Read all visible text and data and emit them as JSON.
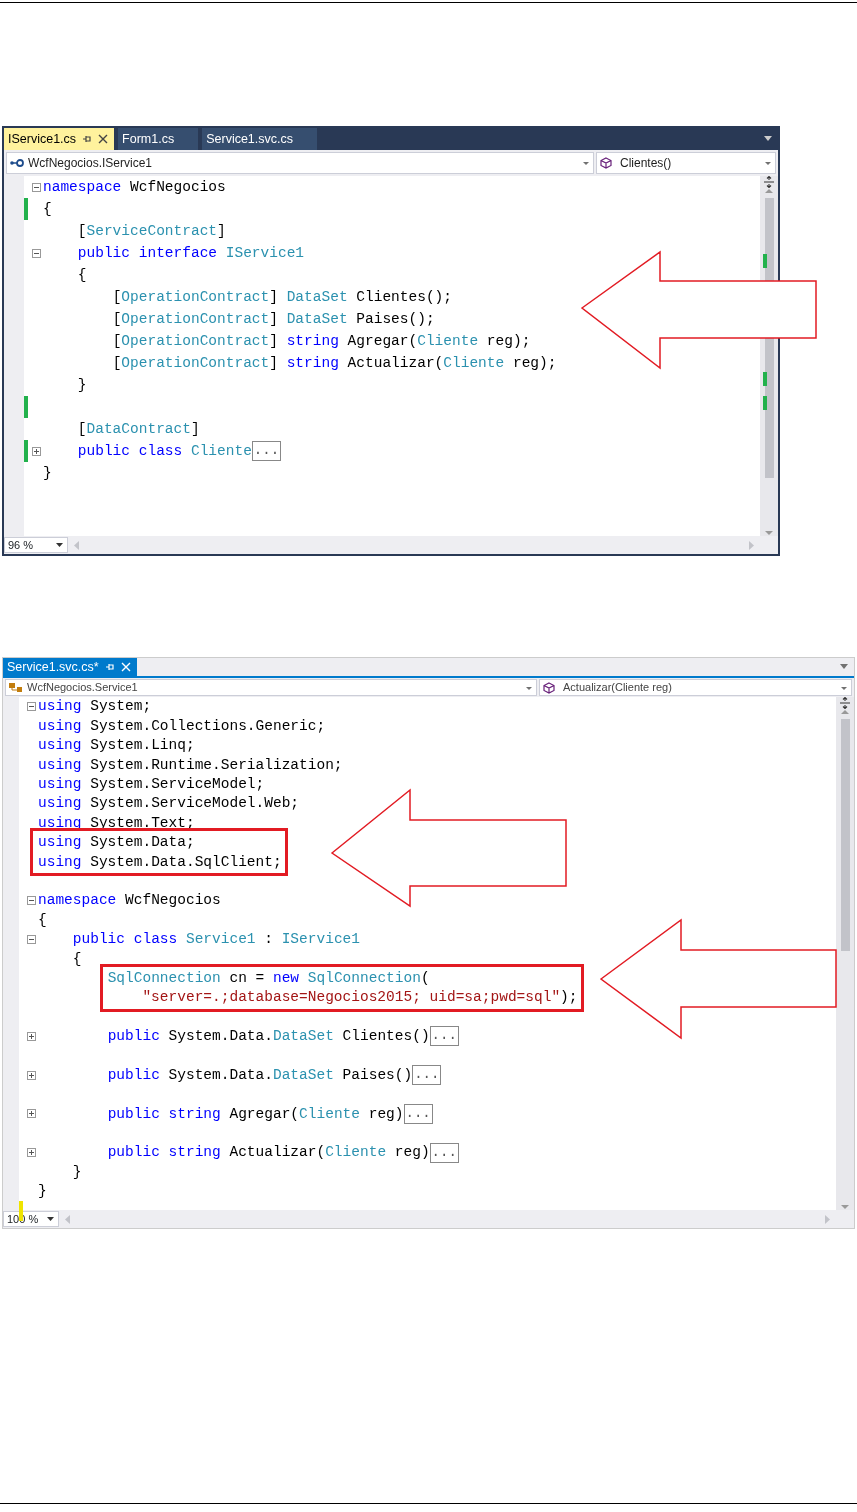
{
  "editors": [
    {
      "kind": "dark",
      "tabs": [
        {
          "label": "IService1.cs",
          "selected": true
        },
        {
          "label": "Form1.cs",
          "selected": false
        },
        {
          "label": "Service1.svc.cs",
          "selected": false
        }
      ],
      "type_dropdown": "WcfNegocios.IService1",
      "member_dropdown": "Clientes()",
      "zoom": "96 %",
      "blocks": [
        {
          "lines": [
            {
              "foldable": true,
              "expanded": true,
              "tokens": [
                {
                  "kind": "kw",
                  "text": "namespace"
                },
                {
                  "kind": "p",
                  "text": " WcfNegocios"
                }
              ]
            },
            {
              "modified": true,
              "saved": true,
              "tokens": [
                {
                  "kind": "p",
                  "text": "{"
                }
              ]
            },
            {
              "tokens": [
                {
                  "kind": "p",
                  "text": "    ["
                },
                {
                  "kind": "type",
                  "text": "ServiceContract"
                },
                {
                  "kind": "p",
                  "text": "]"
                }
              ]
            },
            {
              "foldable": true,
              "expanded": true,
              "tokens": [
                {
                  "kind": "kw",
                  "text": "    public interface"
                },
                {
                  "kind": "type",
                  "text": " IService1"
                }
              ]
            },
            {
              "tokens": [
                {
                  "kind": "p",
                  "text": "    {"
                }
              ]
            },
            {
              "tokens": [
                {
                  "kind": "p",
                  "text": "        ["
                },
                {
                  "kind": "type",
                  "text": "OperationContract"
                },
                {
                  "kind": "p",
                  "text": "]"
                },
                {
                  "kind": "type",
                  "text": " DataSet"
                },
                {
                  "kind": "p",
                  "text": " Clientes();"
                }
              ]
            },
            {
              "tokens": [
                {
                  "kind": "p",
                  "text": "        ["
                },
                {
                  "kind": "type",
                  "text": "OperationContract"
                },
                {
                  "kind": "p",
                  "text": "]"
                },
                {
                  "kind": "type",
                  "text": " DataSet"
                },
                {
                  "kind": "p",
                  "text": " Paises();"
                }
              ]
            },
            {
              "tokens": [
                {
                  "kind": "p",
                  "text": "        ["
                },
                {
                  "kind": "type",
                  "text": "OperationContract"
                },
                {
                  "kind": "p",
                  "text": "]"
                },
                {
                  "kind": "kw",
                  "text": " string"
                },
                {
                  "kind": "p",
                  "text": " Agregar("
                },
                {
                  "kind": "type",
                  "text": "Cliente"
                },
                {
                  "kind": "p",
                  "text": " reg);"
                }
              ]
            },
            {
              "tokens": [
                {
                  "kind": "p",
                  "text": "        ["
                },
                {
                  "kind": "type",
                  "text": "OperationContract"
                },
                {
                  "kind": "p",
                  "text": "]"
                },
                {
                  "kind": "kw",
                  "text": " string"
                },
                {
                  "kind": "p",
                  "text": " Actualizar("
                },
                {
                  "kind": "type",
                  "text": "Cliente"
                },
                {
                  "kind": "p",
                  "text": " reg);"
                }
              ]
            },
            {
              "tokens": [
                {
                  "kind": "p",
                  "text": "    }"
                }
              ]
            },
            {
              "modified": true,
              "saved": true
            },
            {
              "tokens": [
                {
                  "kind": "p",
                  "text": "    ["
                },
                {
                  "kind": "type",
                  "text": "DataContract"
                },
                {
                  "kind": "p",
                  "text": "]"
                }
              ]
            },
            {
              "modified": true,
              "saved": true,
              "foldable": true,
              "expanded": false,
              "tokens": [
                {
                  "kind": "kw",
                  "text": "    public class"
                },
                {
                  "kind": "type",
                  "text": " Cliente"
                },
                {
                  "kind": "collapsed",
                  "text": "..."
                }
              ]
            },
            {
              "tokens": [
                {
                  "kind": "p",
                  "text": "}"
                }
              ]
            }
          ]
        }
      ]
    },
    {
      "kind": "light",
      "tabs": [
        {
          "label": "Service1.svc.cs*",
          "selected": true
        }
      ],
      "type_dropdown": "WcfNegocios.Service1",
      "member_dropdown": "Actualizar(Cliente reg)",
      "zoom": "100 %",
      "blocks": [
        {
          "lines": [
            {
              "foldable": true,
              "expanded": true,
              "tokens": [
                {
                  "kind": "kw",
                  "text": "using"
                },
                {
                  "kind": "p",
                  "text": " System;"
                }
              ]
            },
            {
              "tokens": [
                {
                  "kind": "kw",
                  "text": "using"
                },
                {
                  "kind": "p",
                  "text": " System.Collections.Generic;"
                }
              ]
            },
            {
              "tokens": [
                {
                  "kind": "kw",
                  "text": "using"
                },
                {
                  "kind": "p",
                  "text": " System.Linq;"
                }
              ]
            },
            {
              "tokens": [
                {
                  "kind": "kw",
                  "text": "using"
                },
                {
                  "kind": "p",
                  "text": " System.Runtime.Serialization;"
                }
              ]
            },
            {
              "tokens": [
                {
                  "kind": "kw",
                  "text": "using"
                },
                {
                  "kind": "p",
                  "text": " System.ServiceModel;"
                }
              ]
            },
            {
              "tokens": [
                {
                  "kind": "kw",
                  "text": "using"
                },
                {
                  "kind": "p",
                  "text": " System.ServiceModel.Web;"
                }
              ]
            },
            {
              "tokens": [
                {
                  "kind": "kw",
                  "text": "using"
                },
                {
                  "kind": "p",
                  "text": " System.Text;"
                }
              ]
            },
            {
              "boxed": true,
              "tokens": [
                {
                  "kind": "kw",
                  "text": "using"
                },
                {
                  "kind": "p",
                  "text": " System.Data;"
                }
              ]
            },
            {
              "boxed": true,
              "tokens": [
                {
                  "kind": "kw",
                  "text": "using"
                },
                {
                  "kind": "p",
                  "text": " System.Data.SqlClient;"
                }
              ]
            }
          ]
        },
        {
          "lines": [
            {
              "foldable": true,
              "expanded": true,
              "tokens": [
                {
                  "kind": "kw",
                  "text": "namespace"
                },
                {
                  "kind": "p",
                  "text": " WcfNegocios"
                }
              ]
            },
            {
              "tokens": [
                {
                  "kind": "p",
                  "text": "{"
                }
              ]
            },
            {
              "foldable": true,
              "expanded": true,
              "tokens": [
                {
                  "kind": "kw",
                  "text": "    public class"
                },
                {
                  "kind": "type",
                  "text": " Service1"
                },
                {
                  "kind": "p",
                  "text": " :"
                },
                {
                  "kind": "type",
                  "text": " IService1"
                }
              ]
            },
            {
              "tokens": [
                {
                  "kind": "p",
                  "text": "    {"
                }
              ]
            },
            {
              "boxed": true,
              "tokens": [
                {
                  "kind": "type",
                  "text": "        SqlConnection"
                },
                {
                  "kind": "p",
                  "text": " cn ="
                },
                {
                  "kind": "kw",
                  "text": " new"
                },
                {
                  "kind": "type",
                  "text": " SqlConnection"
                },
                {
                  "kind": "p",
                  "text": "("
                }
              ]
            },
            {
              "boxed": true,
              "tokens": [
                {
                  "kind": "str",
                  "text": "            \"server=.;database=Negocios2015; uid=sa;pwd=sql\""
                },
                {
                  "kind": "p",
                  "text": ");"
                }
              ]
            }
          ]
        },
        {
          "lines": [
            {
              "foldable": true,
              "expanded": false,
              "tokens": [
                {
                  "kind": "kw",
                  "text": "        public"
                },
                {
                  "kind": "p",
                  "text": " System.Data."
                },
                {
                  "kind": "type",
                  "text": "DataSet"
                },
                {
                  "kind": "p",
                  "text": " Clientes()"
                },
                {
                  "kind": "collapsed",
                  "text": "..."
                }
              ]
            }
          ]
        },
        {
          "lines": [
            {
              "foldable": true,
              "expanded": false,
              "tokens": [
                {
                  "kind": "kw",
                  "text": "        public"
                },
                {
                  "kind": "p",
                  "text": " System.Data."
                },
                {
                  "kind": "type",
                  "text": "DataSet"
                },
                {
                  "kind": "p",
                  "text": " Paises()"
                },
                {
                  "kind": "collapsed",
                  "text": "..."
                }
              ]
            }
          ]
        },
        {
          "lines": [
            {
              "foldable": true,
              "expanded": false,
              "tokens": [
                {
                  "kind": "kw",
                  "text": "        public string"
                },
                {
                  "kind": "p",
                  "text": " Agregar("
                },
                {
                  "kind": "type",
                  "text": "Cliente"
                },
                {
                  "kind": "p",
                  "text": " reg)"
                },
                {
                  "kind": "collapsed",
                  "text": "..."
                }
              ]
            }
          ]
        },
        {
          "lines": [
            {
              "foldable": true,
              "expanded": false,
              "tokens": [
                {
                  "kind": "kw",
                  "text": "        public string"
                },
                {
                  "kind": "p",
                  "text": " Actualizar("
                },
                {
                  "kind": "type",
                  "text": "Cliente"
                },
                {
                  "kind": "p",
                  "text": " reg)"
                },
                {
                  "kind": "collapsed",
                  "text": "..."
                }
              ]
            },
            {
              "tokens": [
                {
                  "kind": "p",
                  "text": "    }"
                }
              ]
            },
            {
              "tokens": [
                {
                  "kind": "p",
                  "text": "}"
                }
              ]
            },
            {
              "modified": true,
              "saved": false
            }
          ]
        }
      ]
    }
  ]
}
